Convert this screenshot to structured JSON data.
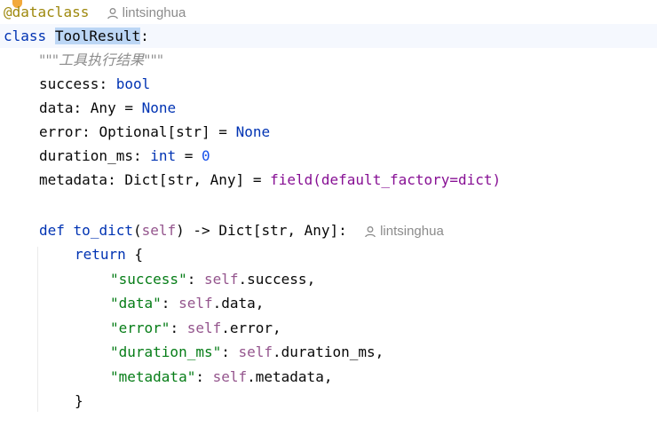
{
  "decorator": {
    "at": "@",
    "name": "dataclass"
  },
  "author": "lintsinghua",
  "class_line": {
    "keyword": "class",
    "name": "ToolResult",
    "colon": ":"
  },
  "docstring": "\"\"\"工具执行结果\"\"\"",
  "fields": [
    {
      "name": "success",
      "sep": ": ",
      "type": "bool"
    },
    {
      "name": "data",
      "sep": ": ",
      "type": "Any",
      "eq": " = ",
      "default": "None"
    },
    {
      "name": "error",
      "sep": ": ",
      "type": "Optional[str]",
      "eq": " = ",
      "default": "None"
    },
    {
      "name": "duration_ms",
      "sep": ": ",
      "type": "int",
      "eq": " = ",
      "default": "0"
    },
    {
      "name": "metadata",
      "sep": ": ",
      "type": "Dict[str, Any]",
      "eq": " = ",
      "default": "field(default_factory=dict)"
    }
  ],
  "method": {
    "def": "def",
    "name": "to_dict",
    "open": "(",
    "self": "self",
    "rest": ") -> Dict[str, Any]:"
  },
  "return_kw": "return",
  "return_open": " {",
  "entries": [
    {
      "key": "\"success\"",
      "colon": ": ",
      "self": "self",
      "attr": ".success,"
    },
    {
      "key": "\"data\"",
      "colon": ": ",
      "self": "self",
      "attr": ".data,"
    },
    {
      "key": "\"error\"",
      "colon": ": ",
      "self": "self",
      "attr": ".error,"
    },
    {
      "key": "\"duration_ms\"",
      "colon": ": ",
      "self": "self",
      "attr": ".duration_ms,"
    },
    {
      "key": "\"metadata\"",
      "colon": ": ",
      "self": "self",
      "attr": ".metadata,"
    }
  ],
  "close_brace": "}",
  "colors": {
    "keyword": "#0033b3",
    "string": "#067d17",
    "number": "#1750eb",
    "self": "#94558d",
    "selection": "#bcd6f5"
  }
}
